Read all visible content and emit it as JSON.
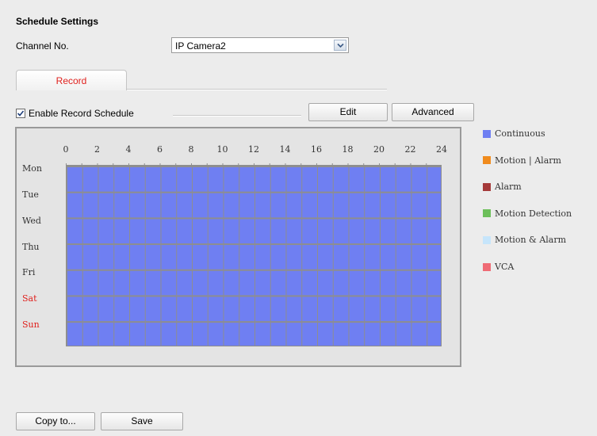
{
  "title": "Schedule Settings",
  "channel": {
    "label": "Channel No.",
    "value": "IP Camera2"
  },
  "tab": {
    "label": "Record"
  },
  "enable_schedule": {
    "label": "Enable Record Schedule",
    "checked": true
  },
  "buttons": {
    "edit": "Edit",
    "advanced": "Advanced",
    "copy": "Copy to...",
    "save": "Save"
  },
  "schedule": {
    "hours": [
      "0",
      "2",
      "4",
      "6",
      "8",
      "10",
      "12",
      "14",
      "16",
      "18",
      "20",
      "22",
      "24"
    ],
    "days": [
      "Mon",
      "Tue",
      "Wed",
      "Thu",
      "Fri",
      "Sat",
      "Sun"
    ],
    "weekend_color": "#e0211d",
    "fill_type": "Continuous",
    "fill_color": "#6f7ff2"
  },
  "legend": [
    {
      "label": "Continuous",
      "color": "#6f7ff2"
    },
    {
      "label": "Motion | Alarm",
      "color": "#f08b1d"
    },
    {
      "label": "Alarm",
      "color": "#a53a3a"
    },
    {
      "label": "Motion Detection",
      "color": "#6cbf5a"
    },
    {
      "label": "Motion & Alarm",
      "color": "#c6e5fb"
    },
    {
      "label": "VCA",
      "color": "#ef6b75"
    }
  ]
}
